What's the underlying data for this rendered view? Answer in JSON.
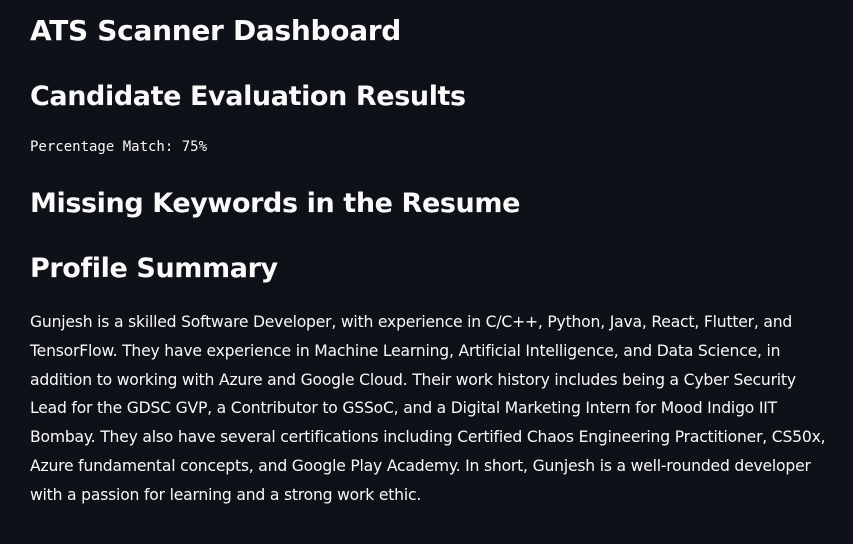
{
  "app": {
    "title": "ATS Scanner Dashboard"
  },
  "results": {
    "heading": "Candidate Evaluation Results",
    "percentage_match_text": "Percentage Match: 75%",
    "percentage_match_value": 75
  },
  "missing_keywords": {
    "heading": "Missing Keywords in the Resume"
  },
  "profile_summary": {
    "heading": "Profile Summary",
    "text": "Gunjesh is a skilled Software Developer, with experience in C/C++, Python, Java, React, Flutter, and TensorFlow. They have experience in Machine Learning, Artificial Intelligence, and Data Science, in addition to working with Azure and Google Cloud. Their work history includes being a Cyber Security Lead for the GDSC GVP, a Contributor to GSSoC, and a Digital Marketing Intern for Mood Indigo IIT Bombay. They also have several certifications including Certified Chaos Engineering Practitioner, CS50x, Azure fundamental concepts, and Google Play Academy. In short, Gunjesh is a well-rounded developer with a passion for learning and a strong work ethic."
  },
  "colors": {
    "background": "#0e1117",
    "text": "#fafafa"
  }
}
